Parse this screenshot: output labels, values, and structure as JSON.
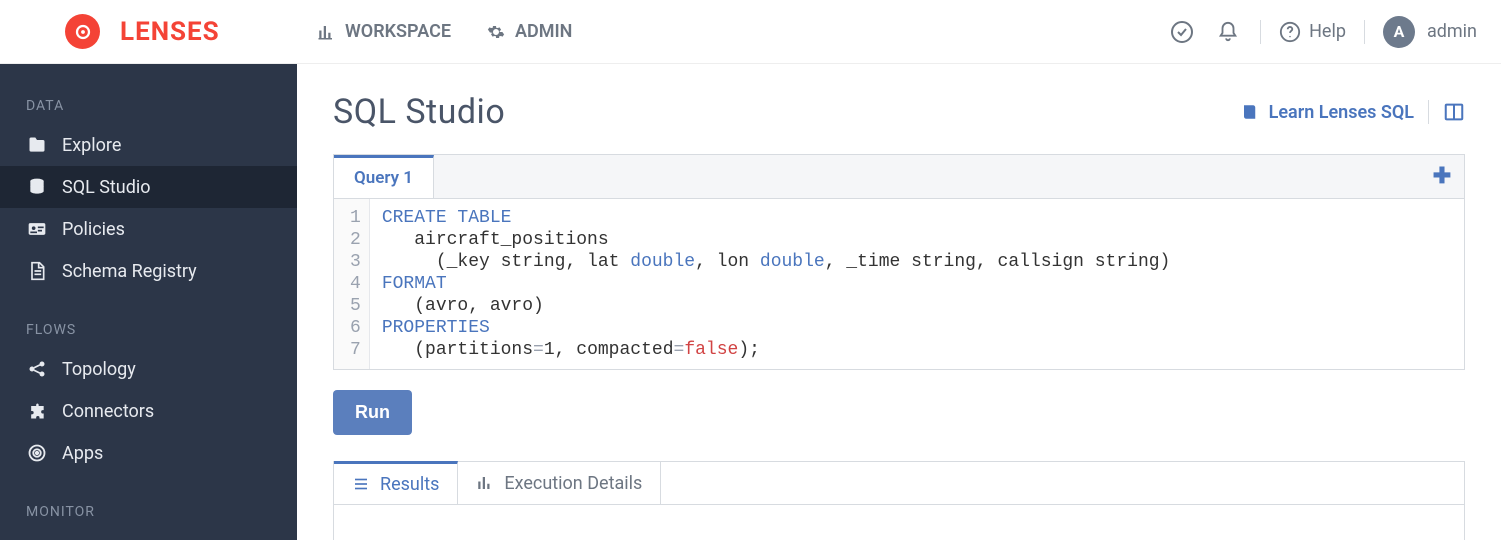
{
  "brand": {
    "text": "LENSES"
  },
  "nav": {
    "workspace": "WORKSPACE",
    "admin": "ADMIN"
  },
  "topbar": {
    "help_label": "Help",
    "user_initial": "A",
    "user_name": "admin"
  },
  "sidebar": {
    "sections": {
      "data": "DATA",
      "flows": "FLOWS",
      "monitor": "MONITOR"
    },
    "items": {
      "explore": "Explore",
      "sql_studio": "SQL Studio",
      "policies": "Policies",
      "schema_registry": "Schema Registry",
      "topology": "Topology",
      "connectors": "Connectors",
      "apps": "Apps"
    }
  },
  "page": {
    "title": "SQL Studio",
    "learn_link": "Learn Lenses SQL",
    "query_tab_label": "Query 1",
    "run_label": "Run"
  },
  "editor": {
    "line_numbers": [
      "1",
      "2",
      "3",
      "4",
      "5",
      "6",
      "7"
    ],
    "lines": [
      {
        "segments": [
          {
            "t": "CREATE TABLE",
            "c": "kw"
          }
        ]
      },
      {
        "segments": [
          {
            "t": "   aircraft_positions",
            "c": ""
          }
        ]
      },
      {
        "segments": [
          {
            "t": "     (_key string, lat ",
            "c": ""
          },
          {
            "t": "double",
            "c": "type"
          },
          {
            "t": ", lon ",
            "c": ""
          },
          {
            "t": "double",
            "c": "type"
          },
          {
            "t": ", _time string, callsign string)",
            "c": ""
          }
        ]
      },
      {
        "segments": [
          {
            "t": "FORMAT",
            "c": "kw"
          }
        ]
      },
      {
        "segments": [
          {
            "t": "   (avro, avro)",
            "c": ""
          }
        ]
      },
      {
        "segments": [
          {
            "t": "PROPERTIES",
            "c": "kw"
          }
        ]
      },
      {
        "segments": [
          {
            "t": "   (partitions",
            "c": ""
          },
          {
            "t": "=",
            "c": "op"
          },
          {
            "t": "1",
            "c": ""
          },
          {
            "t": ", compacted",
            "c": ""
          },
          {
            "t": "=",
            "c": "op"
          },
          {
            "t": "false",
            "c": "lit"
          },
          {
            "t": ");",
            "c": ""
          }
        ]
      }
    ]
  },
  "results": {
    "tab_results": "Results",
    "tab_execution": "Execution Details"
  }
}
